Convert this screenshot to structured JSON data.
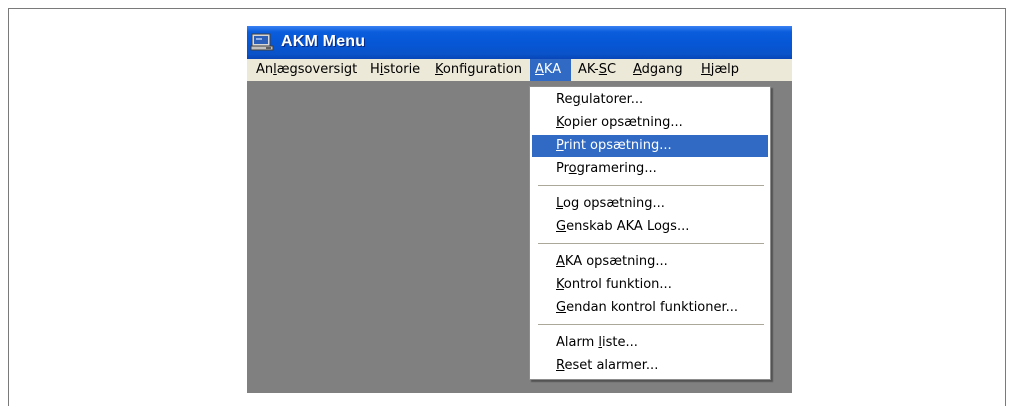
{
  "window": {
    "title": "AKM Menu"
  },
  "menubar": [
    {
      "pre": "An",
      "key": "l",
      "post": "ægsoversigt"
    },
    {
      "pre": "H",
      "key": "i",
      "post": "storie"
    },
    {
      "pre": "",
      "key": "K",
      "post": "onfiguration"
    },
    {
      "pre": "",
      "key": "A",
      "post": "KA",
      "active": true
    },
    {
      "pre": "AK-",
      "key": "S",
      "post": "C"
    },
    {
      "pre": "",
      "key": "A",
      "post": "dgang"
    },
    {
      "pre": "",
      "key": "H",
      "post": "jælp"
    }
  ],
  "dropdown": {
    "items": [
      {
        "pre": "Re",
        "key": "g",
        "post": "ulatorer..."
      },
      {
        "pre": "",
        "key": "K",
        "post": "opier opsætning..."
      },
      {
        "pre": "",
        "key": "P",
        "post": "rint opsætning...",
        "highlighted": true
      },
      {
        "pre": "Pr",
        "key": "o",
        "post": "gramering..."
      },
      {
        "pre": "",
        "key": "L",
        "post": "og opsætning..."
      },
      {
        "pre": "",
        "key": "G",
        "post": "enskab AKA Logs..."
      },
      {
        "pre": "",
        "key": "A",
        "post": "KA opsætning..."
      },
      {
        "pre": "",
        "key": "K",
        "post": "ontrol funktion..."
      },
      {
        "pre": "",
        "key": "G",
        "post": "endan kontrol funktioner..."
      },
      {
        "pre": "Alarm ",
        "key": "l",
        "post": "iste..."
      },
      {
        "pre": "",
        "key": "R",
        "post": "eset alarmer..."
      }
    ]
  },
  "colors": {
    "titlebar": "#0a5ddc",
    "menubar": "#ece9d8",
    "highlight": "#316ac5",
    "client": "#808080"
  }
}
